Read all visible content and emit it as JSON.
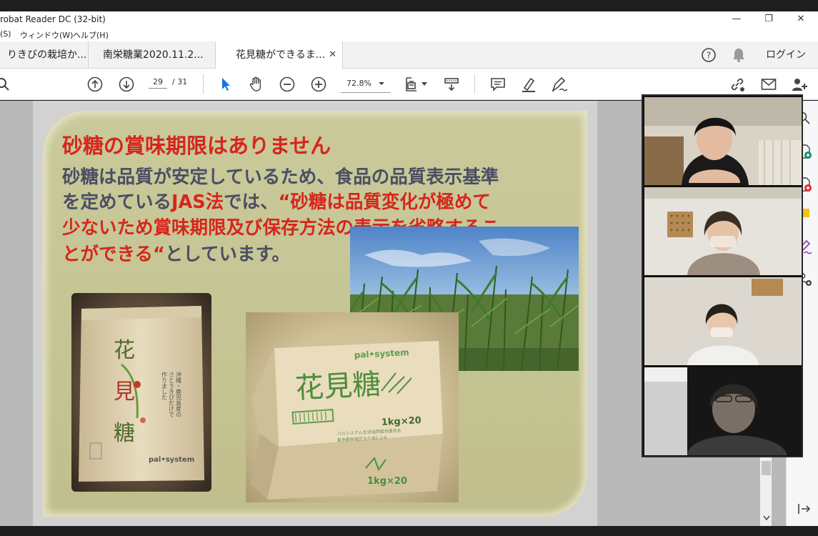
{
  "window": {
    "title": "robat Reader DC (32-bit)",
    "minimize_glyph": "—",
    "restore_glyph": "❐",
    "close_glyph": "✕"
  },
  "menu": {
    "items": [
      "(S)",
      "ウィンドウ(W)",
      "ヘルプ(H)"
    ]
  },
  "tabs": {
    "items": [
      {
        "label": "りきびの栽培か..."
      },
      {
        "label": "南栄糖業2020.11.2..."
      },
      {
        "label": "花見糖ができるま..."
      }
    ],
    "close_glyph": "✕",
    "help_glyph": "?",
    "login_label": "ログイン"
  },
  "toolbar": {
    "current_page": "29",
    "total_pages": "/ 31",
    "zoom": "72.8%",
    "icons": [
      "search-icon",
      "page-up-icon",
      "page-down-icon",
      "select-cursor-icon",
      "hand-icon",
      "zoom-out-icon",
      "zoom-in-icon",
      "fit-page-icon",
      "scroll-mode-icon",
      "comment-icon",
      "highlight-icon",
      "sign-icon",
      "share-link-icon",
      "email-icon",
      "add-user-icon"
    ]
  },
  "slide": {
    "heading": "砂糖の賞味期限はありません",
    "line1": "砂糖は品質が安定しているため、食品の品質表示基準",
    "line2_gray": "を定めている",
    "line2_red": "JAS法",
    "line2_gray2": "では、",
    "line2_red2": "“砂糖は品質変化が極めて",
    "line3": "少ないため賞味期限及び保存方法の表示を省略するこ",
    "line4_red": "とができる“",
    "line4_gray": "としています。",
    "bag": {
      "kanji": [
        "花",
        "見",
        "糖"
      ],
      "desc_lines": [
        "沖縄・鹿児島産の",
        "さとうきびだけで",
        "作りました"
      ],
      "brand": "pal•system"
    },
    "box": {
      "brand": "pal•system",
      "name": "花見糖",
      "weight": "1kg×20",
      "fine_print": [
        "パルシステム生活協同組合連合会",
        "東京都新宿区大久保2-2-6"
      ],
      "weight_side": "1kg×20"
    }
  },
  "colors": {
    "slide_bg": "#c7c696",
    "heading_red": "#d6261c",
    "body_gray": "#4a4f63",
    "accent_blue": "#1473e6"
  }
}
